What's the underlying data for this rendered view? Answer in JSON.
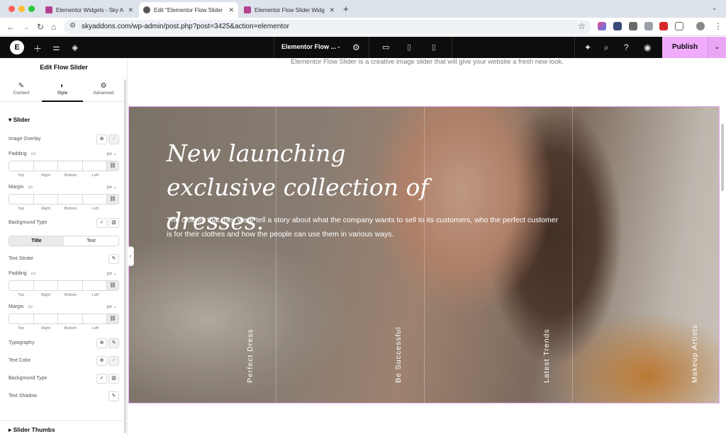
{
  "browser": {
    "tabs": [
      {
        "label": "Elementor Widgets - Sky Addo",
        "active": false
      },
      {
        "label": "Edit \"Elementor Flow Slider W",
        "active": true
      },
      {
        "label": "Elementor Flow Slider Widget",
        "active": false
      }
    ],
    "new_tab": "+",
    "close_glyph": "✕",
    "url": "skyaddons.com/wp-admin/post.php?post=3425&action=elementor"
  },
  "topbar": {
    "doc_title": "Elementor Flow ...",
    "publish_label": "Publish"
  },
  "panel": {
    "title": "Edit Flow Slider",
    "tabs": [
      {
        "label": "Content",
        "icon": "pencil-icon"
      },
      {
        "label": "Style",
        "icon": "contrast-icon"
      },
      {
        "label": "Advanced",
        "icon": "gear-icon"
      }
    ],
    "section_slider": "Slider",
    "image_overlay": "Image Overlay",
    "padding": "Padding",
    "margin": "Margin",
    "background_type": "Background Type",
    "unit": "px",
    "dim_labels": [
      "Top",
      "Right",
      "Bottom",
      "Left"
    ],
    "switch_title": "Title",
    "switch_text": "Text",
    "text_stroke": "Text Stroke",
    "padding2": "Padding",
    "margin2": "Margin",
    "typography": "Typography",
    "text_color": "Text Color",
    "background_type2": "Background Type",
    "text_shadow": "Text Shadow",
    "section_thumbs": "Slider Thumbs"
  },
  "canvas": {
    "intro": "Elementor Flow Slider is a creative image slider that will give your website a fresh new look.",
    "slide_title": "New launching exclusive collection of dresses.",
    "slide_text": "The clothes that they wear tell a story about what the company wants to sell to its customers, who the perfect customer is for their clothes and how the people can use them in various ways.",
    "thumb_labels": [
      "Perfect Dress",
      "Be Successful",
      "Latest Trends",
      "Makeup Artists"
    ]
  },
  "colors": {
    "publish": "#f0abfc",
    "topbar": "#0c0d0e",
    "slider_border": "#e6a8f0"
  }
}
